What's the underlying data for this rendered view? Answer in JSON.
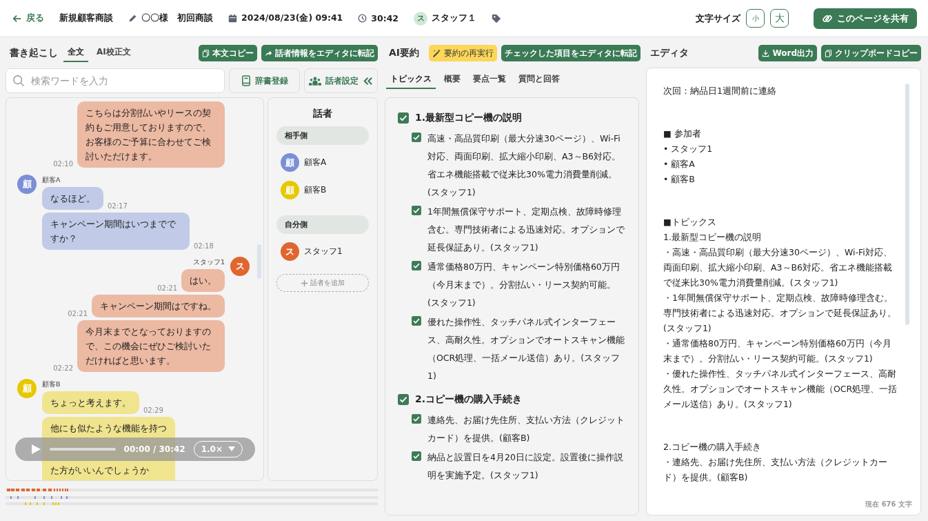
{
  "header": {
    "back": "戻る",
    "meeting_type": "新規顧客商談",
    "title": "〇〇様　初回商談",
    "datetime": "2024/08/23(金) 09:41",
    "duration": "30:42",
    "staff": {
      "avatar": "ス",
      "name": "スタッフ１"
    },
    "font_size_label": "文字サイズ",
    "font_buttons": [
      "小",
      "大"
    ],
    "share": "このページを共有"
  },
  "transcript": {
    "title": "書き起こし",
    "tabs": [
      {
        "label": "全文",
        "selected": true
      },
      {
        "label": "AI校正文",
        "selected": false
      }
    ],
    "buttons": [
      "本文コピー",
      "話者情報をエディタに転記"
    ],
    "search": {
      "placeholder": "検索ワードを入力"
    },
    "dictionary": "辞書登録",
    "speaker_settings": "話者設定",
    "messages": [
      {
        "kind": "self",
        "color": "#ecb9a3",
        "text": "こちらは分割払いやリースの契約もご用意しておりますので、お客様のご予算に合わせてご検討いただけます。",
        "time": "02:10"
      },
      {
        "kind": "other",
        "color": "#c1cbe8",
        "avatar": {
          "letter": "顧",
          "color": "#7b8fd6"
        },
        "name": "顧客A",
        "text": "なるほど。",
        "time": "02:17"
      },
      {
        "kind": "other",
        "color": "#c1cbe8",
        "text": "キャンペーン期間はいつまでですか？",
        "time": "02:18"
      },
      {
        "kind": "self",
        "color": "#ecb9a3",
        "avatar": {
          "letter": "ス",
          "color": "#e0662f"
        },
        "name": "スタッフ1",
        "text": "はい。",
        "time": "02:21"
      },
      {
        "kind": "self",
        "color": "#ecb9a3",
        "text": "キャンペーン期間はですね。",
        "time": "02:21"
      },
      {
        "kind": "self",
        "color": "#ecb9a3",
        "text": "今月末までとなっておりますので、この機会にぜひご検討いただければと思います。",
        "time": "02:22"
      },
      {
        "kind": "other",
        "color": "#f0e48f",
        "avatar": {
          "letter": "顧",
          "color": "#e6c800"
        },
        "name": "顧客B",
        "text": "ちょっと考えます。",
        "time": "02:29"
      },
      {
        "kind": "other",
        "color": "#f0e48f",
        "text": "他にも似たような機能を持つ",
        "tail": "た方がいいんでしょうか"
      }
    ],
    "player": {
      "time": "00:00 / 30:42",
      "speed": "1.0×"
    }
  },
  "speakers": {
    "title": "話者",
    "groups": [
      {
        "label": "相手側",
        "members": [
          {
            "avatar": "顧",
            "name": "顧客A",
            "color": "#7b8fd6"
          },
          {
            "avatar": "顧",
            "name": "顧客B",
            "color": "#e6c800"
          }
        ]
      },
      {
        "label": "自分側",
        "members": [
          {
            "avatar": "ス",
            "name": "スタッフ1",
            "color": "#e0662f"
          }
        ]
      }
    ],
    "add": "話者を追加"
  },
  "summary": {
    "title": "AI要約",
    "rerun": "要約の再実行",
    "transfer": "チェックした項目をエディタに転記",
    "tabs": [
      {
        "label": "トピックス",
        "selected": true
      },
      {
        "label": "概要",
        "selected": false
      },
      {
        "label": "要点一覧",
        "selected": false
      },
      {
        "label": "質問と回答",
        "selected": false
      }
    ],
    "topics": [
      {
        "title": "1.最新型コピー機の説明",
        "checked": true,
        "items": [
          {
            "text": "高速・高品質印刷（最大分速30ページ）、Wi-Fi対応、両面印刷、拡大縮小印刷、A3～B6対応。省エネ機能搭載で従来比30%電力消費量削減。(スタッフ1)",
            "checked": true
          },
          {
            "text": "1年間無償保守サポート、定期点検、故障時修理含む。専門技術者による迅速対応。オプションで延長保証あり。(スタッフ1)",
            "checked": true
          },
          {
            "text": "通常価格80万円、キャンペーン特別価格60万円（今月末まで）。分割払い・リース契約可能。(スタッフ1)",
            "checked": true
          },
          {
            "text": "優れた操作性、タッチパネル式インターフェース、高耐久性。オプションでオートスキャン機能（OCR処理、一括メール送信）あり。(スタッフ1)",
            "checked": true
          }
        ]
      },
      {
        "title": "2.コピー機の購入手続き",
        "checked": true,
        "items": [
          {
            "text": "連絡先、お届け先住所、支払い方法（クレジットカード）を提供。(顧客B)",
            "checked": true
          },
          {
            "text": "納品と設置日を4月20日に設定。設置後に操作説明を実施予定。(スタッフ1)",
            "checked": true
          }
        ]
      }
    ]
  },
  "editor": {
    "title": "エディタ",
    "buttons": [
      "Word出力",
      "クリップボードコピー"
    ],
    "paragraphs": [
      [
        "次回：納品日1週間前に連絡"
      ],
      [
        "■ 参加者",
        "• スタッフ1",
        "• 顧客A",
        "• 顧客B"
      ],
      [
        "■トピックス",
        "1.最新型コピー機の説明",
        "・高速・高品質印刷（最大分速30ページ）、Wi-Fi対応、両面印刷、拡大縮小印刷、A3～B6対応。省エネ機能搭載で従来比30%電力消費量削減。(スタッフ1)",
        "・1年間無償保守サポート、定期点検、故障時修理含む。専門技術者による迅速対応。オプションで延長保証あり。(スタッフ1)",
        "・通常価格80万円、キャンペーン特別価格60万円（今月末まで）。分割払い・リース契約可能。(スタッフ1)",
        "・優れた操作性、タッチパネル式インターフェース、高耐久性。オプションでオートスキャン機能（OCR処理、一括メール送信）あり。(スタッフ1)"
      ],
      [
        "2.コピー機の購入手続き",
        "・連絡先、お届け先住所、支払い方法（クレジットカード）を提供。(顧客B)"
      ]
    ],
    "count": "現在 676 文字"
  }
}
